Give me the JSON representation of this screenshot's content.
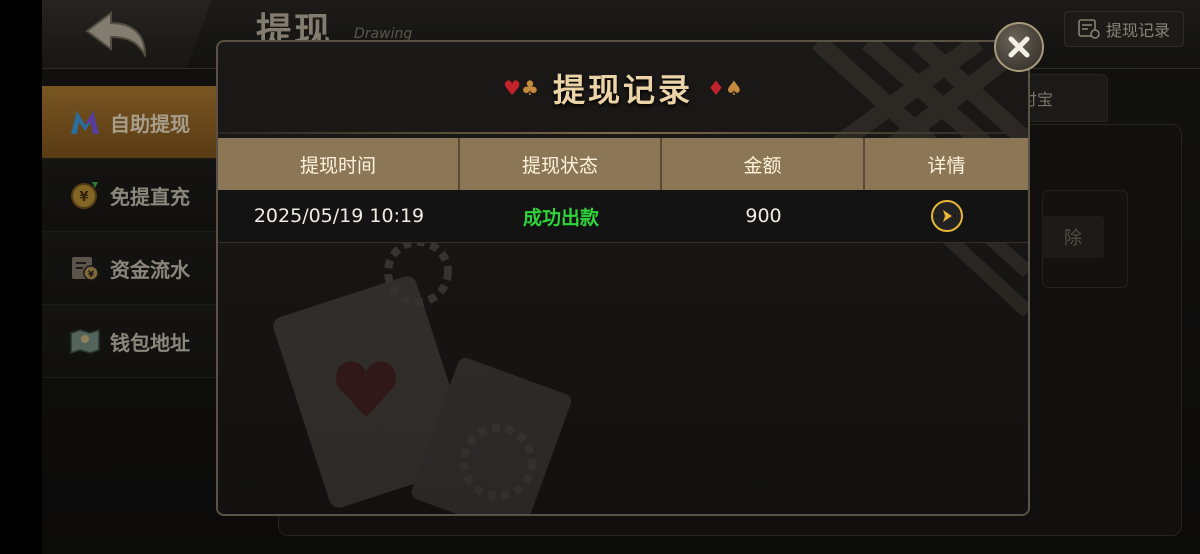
{
  "header": {
    "title": "提现",
    "subtitle": "Drawing",
    "records_button": "提现记录"
  },
  "sidebar": {
    "items": [
      {
        "label": "自助提现",
        "icon": "m-logo-icon",
        "active": true
      },
      {
        "label": "免提直充",
        "icon": "coin-icon",
        "active": false
      },
      {
        "label": "资金流水",
        "icon": "ledger-icon",
        "active": false
      },
      {
        "label": "钱包地址",
        "icon": "map-icon",
        "active": false
      }
    ]
  },
  "background": {
    "tab_label": "付宝",
    "button_label": "除"
  },
  "modal": {
    "title": "提现记录",
    "columns": [
      "提现时间",
      "提现状态",
      "金额",
      "详情"
    ],
    "rows": [
      {
        "time": "2025/05/19 10:19",
        "status": "成功出款",
        "amount": "900"
      }
    ]
  },
  "colors": {
    "accent_gold": "#ecd3a8",
    "table_header": "#8b7656",
    "status_success": "#2fd43b",
    "active_tab": "#b88437"
  }
}
